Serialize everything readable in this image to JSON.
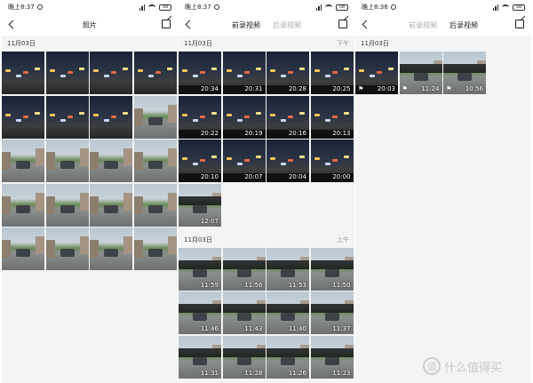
{
  "status_bars": {
    "p1": {
      "time": "晚上8:37",
      "battery": "58"
    },
    "p2": {
      "time": "晚上8:37",
      "battery": "58"
    },
    "p3": {
      "time": "晚上8:38",
      "battery": "58"
    }
  },
  "panel1": {
    "title": "照片",
    "section": {
      "date": "11月03日"
    },
    "thumbs": 20
  },
  "panel2": {
    "tabs": [
      {
        "label": "前录视频",
        "active": true
      },
      {
        "label": "后录视频",
        "active": false
      }
    ],
    "sections": [
      {
        "date": "11月03日",
        "period": "下午",
        "times": [
          "20:34",
          "20:31",
          "20:28",
          "20:25",
          "20:22",
          "20:19",
          "20:16",
          "20:13",
          "20:10",
          "20:07",
          "20:04",
          "20:00",
          "12:07"
        ]
      },
      {
        "date": "11月03日",
        "period": "上午",
        "times": [
          "11:59",
          "11:56",
          "11:53",
          "11:50",
          "11:46",
          "11:43",
          "11:40",
          "11:37",
          "11:31",
          "11:28",
          "11:26",
          "11:23"
        ]
      }
    ]
  },
  "panel3": {
    "tabs": [
      {
        "label": "前录视频",
        "active": false
      },
      {
        "label": "后录视频",
        "active": true
      }
    ],
    "sections": [
      {
        "date": "11月03日",
        "times": [
          "20:03",
          "11:24",
          "10:56"
        ]
      }
    ]
  },
  "watermark": {
    "icon": "值",
    "text": "什么值得买"
  }
}
